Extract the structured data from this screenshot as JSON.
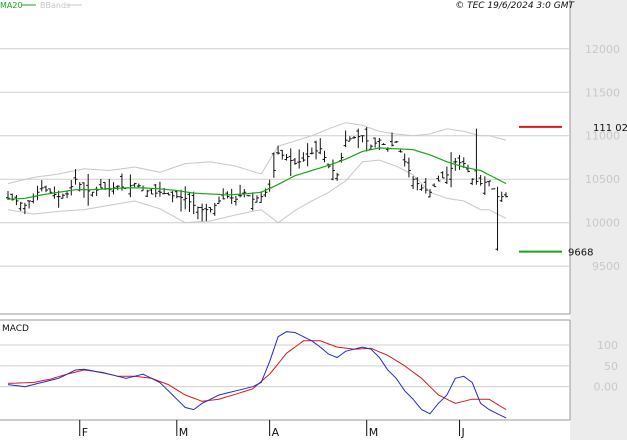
{
  "header": {
    "legend": [
      {
        "label": "MA20",
        "color": "#1aa51a"
      },
      {
        "label": "BBands",
        "color": "#c8c8c8"
      }
    ],
    "credit": "© TEC 19/6/2024 3:0 GMT"
  },
  "colors": {
    "background": "#ffffff",
    "right_band": "#ececec",
    "grid": "#cfcfcf",
    "price_bar": "#111111",
    "ma20": "#1aa51a",
    "bbands": "#c8c8c8",
    "macd_line": "#1e2ad8",
    "signal_line": "#d41c1c",
    "high_marker": "#d41c1c",
    "low_marker": "#1aa51a"
  },
  "chart_data": [
    {
      "type": "ohlc",
      "title": "",
      "y_ticks": [
        9500,
        10000,
        10500,
        11000,
        11500,
        12000
      ],
      "y_tick_labels": [
        "9500",
        "10000",
        "10500",
        "11000",
        "11500",
        "12000"
      ],
      "ylim": [
        8950,
        12400
      ],
      "x_ticks": [
        {
          "label": "F",
          "index": 17
        },
        {
          "label": "M",
          "index": 40
        },
        {
          "label": "A",
          "index": 62
        },
        {
          "label": "M",
          "index": 85
        },
        {
          "label": "J",
          "index": 107
        }
      ],
      "n_bars": 119,
      "anchors": [
        [
          0,
          10280
        ],
        [
          2,
          10250
        ],
        [
          4,
          10200
        ],
        [
          6,
          10300
        ],
        [
          8,
          10400
        ],
        [
          10,
          10350
        ],
        [
          12,
          10300
        ],
        [
          14,
          10330
        ],
        [
          16,
          10500
        ],
        [
          18,
          10380
        ],
        [
          20,
          10350
        ],
        [
          22,
          10400
        ],
        [
          24,
          10380
        ],
        [
          26,
          10420
        ],
        [
          28,
          10400
        ],
        [
          30,
          10450
        ],
        [
          32,
          10400
        ],
        [
          34,
          10330
        ],
        [
          36,
          10350
        ],
        [
          38,
          10320
        ],
        [
          40,
          10300
        ],
        [
          42,
          10280
        ],
        [
          44,
          10200
        ],
        [
          46,
          10150
        ],
        [
          48,
          10150
        ],
        [
          50,
          10250
        ],
        [
          52,
          10300
        ],
        [
          54,
          10270
        ],
        [
          56,
          10350
        ],
        [
          58,
          10270
        ],
        [
          60,
          10300
        ],
        [
          62,
          10400
        ],
        [
          64,
          10800
        ],
        [
          66,
          10750
        ],
        [
          68,
          10680
        ],
        [
          70,
          10720
        ],
        [
          72,
          10800
        ],
        [
          74,
          10850
        ],
        [
          76,
          10650
        ],
        [
          78,
          10550
        ],
        [
          80,
          10950
        ],
        [
          82,
          10980
        ],
        [
          84,
          11000
        ],
        [
          86,
          10880
        ],
        [
          88,
          10950
        ],
        [
          90,
          10850
        ],
        [
          92,
          10930
        ],
        [
          94,
          10700
        ],
        [
          96,
          10500
        ],
        [
          98,
          10400
        ],
        [
          100,
          10350
        ],
        [
          102,
          10480
        ],
        [
          104,
          10550
        ],
        [
          106,
          10700
        ],
        [
          108,
          10680
        ],
        [
          110,
          10500
        ],
        [
          112,
          10450
        ],
        [
          114,
          10480
        ],
        [
          116,
          10300
        ],
        [
          118,
          10300
        ]
      ],
      "highs_lows": {
        "high": "111 02",
        "low": "9668"
      },
      "high_value": 11102,
      "low_value": 9668,
      "series": [
        {
          "name": "MA20",
          "anchors": [
            [
              0,
              10270
            ],
            [
              4,
              10280
            ],
            [
              8,
              10320
            ],
            [
              12,
              10350
            ],
            [
              16,
              10380
            ],
            [
              20,
              10380
            ],
            [
              24,
              10390
            ],
            [
              28,
              10400
            ],
            [
              32,
              10400
            ],
            [
              36,
              10390
            ],
            [
              40,
              10370
            ],
            [
              44,
              10340
            ],
            [
              48,
              10330
            ],
            [
              52,
              10320
            ],
            [
              56,
              10330
            ],
            [
              60,
              10350
            ],
            [
              64,
              10440
            ],
            [
              68,
              10540
            ],
            [
              72,
              10600
            ],
            [
              76,
              10660
            ],
            [
              80,
              10730
            ],
            [
              84,
              10820
            ],
            [
              88,
              10860
            ],
            [
              92,
              10850
            ],
            [
              96,
              10840
            ],
            [
              100,
              10780
            ],
            [
              104,
              10700
            ],
            [
              108,
              10640
            ],
            [
              112,
              10600
            ],
            [
              114,
              10550
            ],
            [
              118,
              10450
            ]
          ]
        },
        {
          "name": "BBands",
          "anchors": [
            [
              0,
              10150
            ],
            [
              6,
              10100
            ],
            [
              12,
              10130
            ],
            [
              18,
              10150
            ],
            [
              24,
              10200
            ],
            [
              30,
              10250
            ],
            [
              36,
              10160
            ],
            [
              42,
              10000
            ],
            [
              48,
              10020
            ],
            [
              54,
              10090
            ],
            [
              60,
              10150
            ],
            [
              64,
              10000
            ],
            [
              68,
              10140
            ],
            [
              72,
              10250
            ],
            [
              76,
              10350
            ],
            [
              80,
              10480
            ],
            [
              84,
              10700
            ],
            [
              88,
              10720
            ],
            [
              92,
              10650
            ],
            [
              96,
              10550
            ],
            [
              100,
              10350
            ],
            [
              104,
              10280
            ],
            [
              108,
              10250
            ],
            [
              112,
              10150
            ],
            [
              114,
              10150
            ],
            [
              118,
              10050
            ]
          ]
        },
        {
          "name": "BBands",
          "anchors": [
            [
              0,
              10450
            ],
            [
              6,
              10520
            ],
            [
              12,
              10560
            ],
            [
              18,
              10620
            ],
            [
              24,
              10600
            ],
            [
              30,
              10640
            ],
            [
              36,
              10580
            ],
            [
              42,
              10680
            ],
            [
              48,
              10700
            ],
            [
              54,
              10650
            ],
            [
              60,
              10560
            ],
            [
              64,
              10880
            ],
            [
              68,
              10940
            ],
            [
              72,
              11000
            ],
            [
              76,
              11080
            ],
            [
              80,
              11150
            ],
            [
              84,
              11120
            ],
            [
              88,
              11050
            ],
            [
              92,
              11020
            ],
            [
              96,
              11000
            ],
            [
              100,
              11020
            ],
            [
              104,
              11080
            ],
            [
              108,
              11050
            ],
            [
              112,
              11000
            ],
            [
              114,
              11000
            ],
            [
              118,
              10950
            ]
          ]
        }
      ]
    },
    {
      "type": "line",
      "title": "MACD",
      "y_ticks": [
        0,
        50,
        100
      ],
      "y_tick_labels": [
        "0.00",
        "50",
        "100"
      ],
      "ylim": [
        -80,
        160
      ],
      "series": [
        {
          "name": "MACD",
          "anchors": [
            [
              0,
              5
            ],
            [
              4,
              0
            ],
            [
              8,
              10
            ],
            [
              12,
              20
            ],
            [
              16,
              40
            ],
            [
              18,
              42
            ],
            [
              20,
              38
            ],
            [
              24,
              30
            ],
            [
              28,
              20
            ],
            [
              32,
              30
            ],
            [
              36,
              10
            ],
            [
              40,
              -30
            ],
            [
              42,
              -50
            ],
            [
              44,
              -55
            ],
            [
              46,
              -40
            ],
            [
              50,
              -20
            ],
            [
              54,
              -10
            ],
            [
              58,
              0
            ],
            [
              60,
              10
            ],
            [
              62,
              60
            ],
            [
              64,
              120
            ],
            [
              66,
              132
            ],
            [
              68,
              130
            ],
            [
              70,
              120
            ],
            [
              72,
              110
            ],
            [
              74,
              95
            ],
            [
              76,
              78
            ],
            [
              78,
              70
            ],
            [
              80,
              85
            ],
            [
              82,
              90
            ],
            [
              84,
              95
            ],
            [
              86,
              90
            ],
            [
              88,
              70
            ],
            [
              90,
              40
            ],
            [
              92,
              20
            ],
            [
              94,
              -10
            ],
            [
              96,
              -30
            ],
            [
              98,
              -55
            ],
            [
              100,
              -65
            ],
            [
              102,
              -40
            ],
            [
              104,
              -20
            ],
            [
              106,
              20
            ],
            [
              108,
              25
            ],
            [
              110,
              10
            ],
            [
              112,
              -40
            ],
            [
              114,
              -55
            ],
            [
              118,
              -75
            ]
          ]
        },
        {
          "name": "Signal",
          "anchors": [
            [
              0,
              8
            ],
            [
              6,
              10
            ],
            [
              10,
              18
            ],
            [
              14,
              30
            ],
            [
              18,
              40
            ],
            [
              22,
              35
            ],
            [
              26,
              25
            ],
            [
              30,
              25
            ],
            [
              34,
              20
            ],
            [
              38,
              5
            ],
            [
              42,
              -20
            ],
            [
              46,
              -35
            ],
            [
              50,
              -30
            ],
            [
              54,
              -18
            ],
            [
              58,
              -5
            ],
            [
              62,
              30
            ],
            [
              66,
              80
            ],
            [
              70,
              110
            ],
            [
              74,
              110
            ],
            [
              78,
              95
            ],
            [
              82,
              90
            ],
            [
              86,
              92
            ],
            [
              90,
              75
            ],
            [
              94,
              50
            ],
            [
              98,
              20
            ],
            [
              102,
              -20
            ],
            [
              106,
              -40
            ],
            [
              110,
              -30
            ],
            [
              114,
              -30
            ],
            [
              118,
              -55
            ]
          ]
        }
      ]
    }
  ]
}
